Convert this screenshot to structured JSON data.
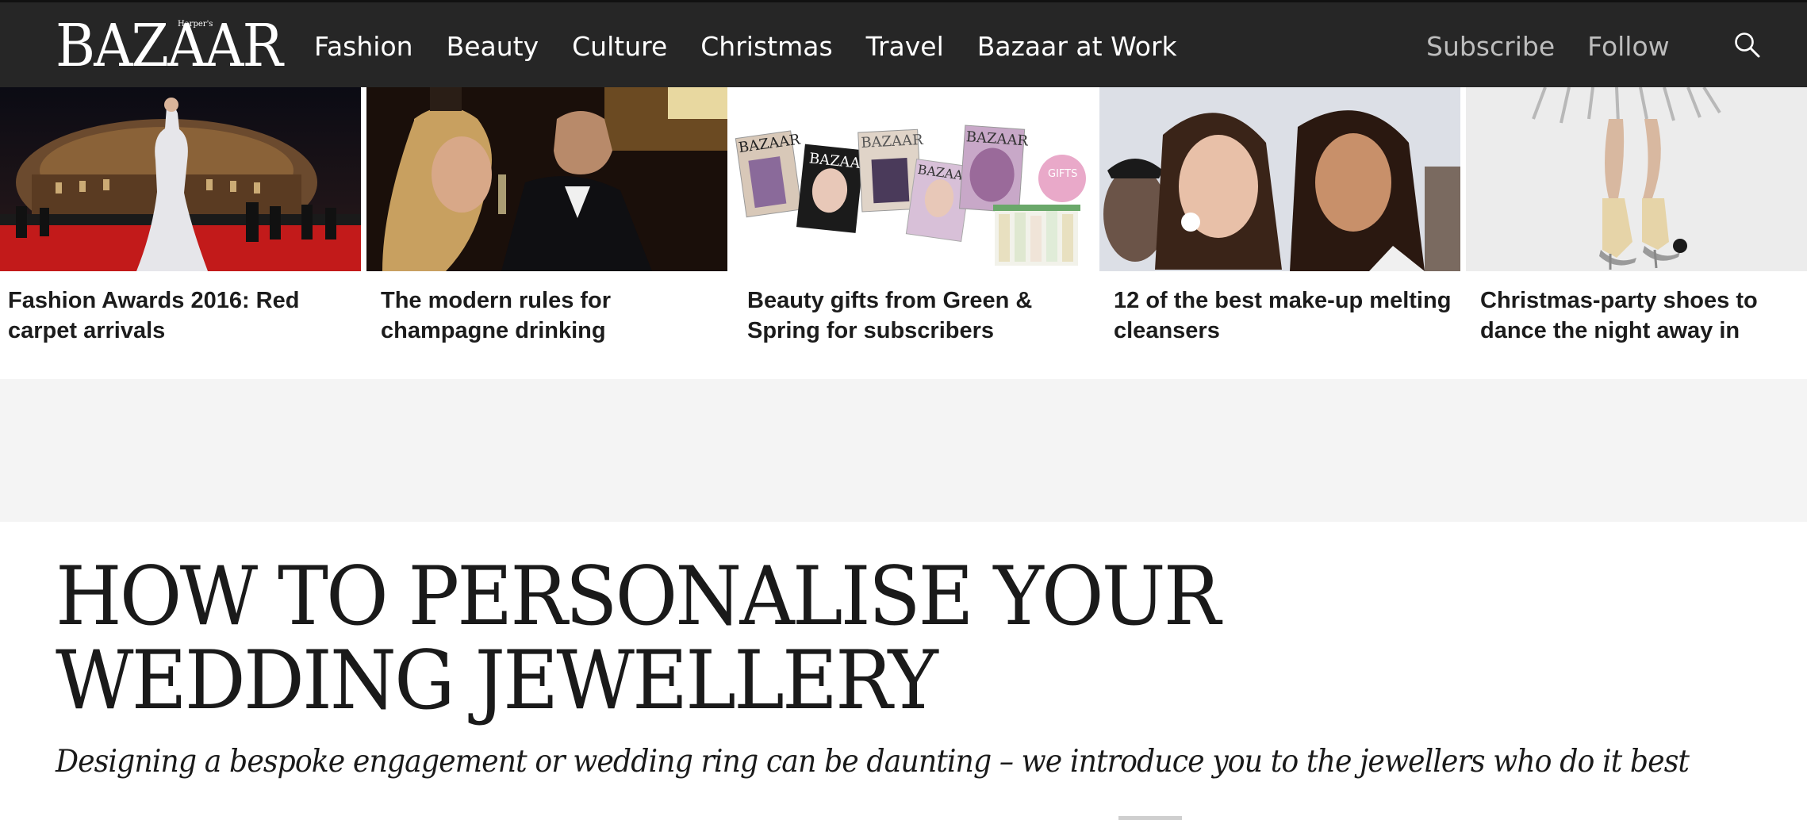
{
  "nav": {
    "logo": "BAZAAR",
    "logo_small": "Harper's",
    "links": [
      "Fashion",
      "Beauty",
      "Culture",
      "Christmas",
      "Travel",
      "Bazaar at Work"
    ],
    "subscribe": "Subscribe",
    "follow": "Follow",
    "search_icon": "search-icon"
  },
  "cards": [
    {
      "title": "Fashion Awards 2016: Red carpet arrivals"
    },
    {
      "title": "The modern rules for champagne drinking"
    },
    {
      "title": "Beauty gifts from Green & Spring for subscribers"
    },
    {
      "title": "12 of the best make-up melting cleansers"
    },
    {
      "title": "Christmas-party shoes to dance the night away in"
    }
  ],
  "card3_image_text": {
    "magazine_logo_1": "BAZAAR",
    "magazine_logo_2": "BAZAAR",
    "magazine_logo_3": "BAZAAR",
    "magazine_logo_4": "BAZAAR",
    "magazine_logo_5": "BAZAAR",
    "badge": "GIFTS"
  },
  "article": {
    "headline": "HOW TO PERSONALISE YOUR WEDDING JEWELLERY",
    "standfirst": "Designing a bespoke engagement or wedding ring can be daunting – we introduce you to the jewellers who do it best"
  },
  "colors": {
    "nav_bg": "#262626",
    "ad_band": "#f4f4f4",
    "text": "#1a1a1a"
  }
}
